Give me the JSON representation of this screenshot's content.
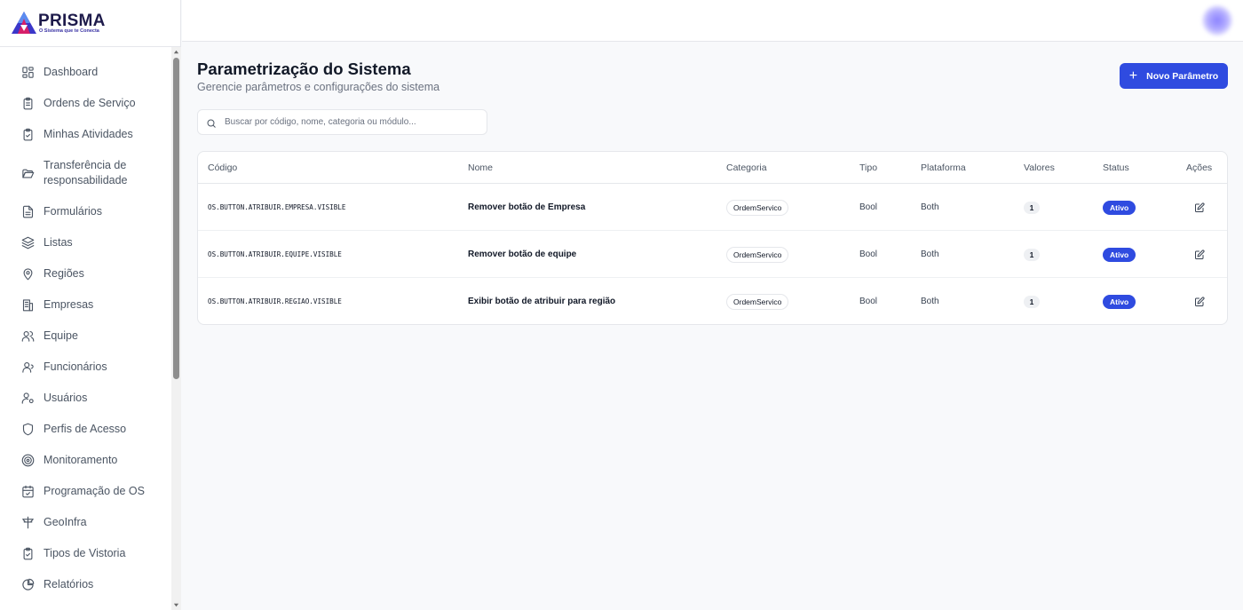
{
  "brand": {
    "name": "PRISMA",
    "tagline": "O Sistema que te Conecta"
  },
  "sidebar": {
    "items": [
      {
        "label": "Dashboard",
        "icon": "layout-grid-icon"
      },
      {
        "label": "Ordens de Serviço",
        "icon": "clipboard-icon"
      },
      {
        "label": "Minhas Atividades",
        "icon": "clipboard-check-icon"
      },
      {
        "label": "Transferência de responsabilidade",
        "icon": "folder-open-icon"
      },
      {
        "label": "Formulários",
        "icon": "file-text-icon"
      },
      {
        "label": "Listas",
        "icon": "layers-icon"
      },
      {
        "label": "Regiões",
        "icon": "map-pin-icon"
      },
      {
        "label": "Empresas",
        "icon": "building-icon"
      },
      {
        "label": "Equipe",
        "icon": "users-icon"
      },
      {
        "label": "Funcionários",
        "icon": "user-group-icon"
      },
      {
        "label": "Usuários",
        "icon": "user-cog-icon"
      },
      {
        "label": "Perfis de Acesso",
        "icon": "shield-icon"
      },
      {
        "label": "Monitoramento",
        "icon": "radar-icon"
      },
      {
        "label": "Programação de OS",
        "icon": "calendar-check-icon"
      },
      {
        "label": "GeoInfra",
        "icon": "utility-pole-icon"
      },
      {
        "label": "Tipos de Vistoria",
        "icon": "clipboard-check-icon"
      },
      {
        "label": "Relatórios",
        "icon": "pie-chart-icon"
      }
    ]
  },
  "main": {
    "title": "Parametrização do Sistema",
    "subtitle": "Gerencie parâmetros e configurações do sistema",
    "new_button": "Novo Parâmetro",
    "search": {
      "placeholder": "Buscar por código, nome, categoria ou módulo...",
      "value": ""
    }
  },
  "table": {
    "columns": [
      "Código",
      "Nome",
      "Categoria",
      "Tipo",
      "Plataforma",
      "Valores",
      "Status",
      "Ações"
    ],
    "rows": [
      {
        "codigo": "OS.BUTTON.ATRIBUIR.EMPRESA.VISIBLE",
        "nome": "Remover botão de Empresa",
        "categoria": "OrdemServico",
        "tipo": "Bool",
        "plataforma": "Both",
        "valores": "1",
        "status": "Ativo"
      },
      {
        "codigo": "OS.BUTTON.ATRIBUIR.EQUIPE.VISIBLE",
        "nome": "Remover botão de equipe",
        "categoria": "OrdemServico",
        "tipo": "Bool",
        "plataforma": "Both",
        "valores": "1",
        "status": "Ativo"
      },
      {
        "codigo": "OS.BUTTON.ATRIBUIR.REGIAO.VISIBLE",
        "nome": "Exibir botão de atribuir para região",
        "categoria": "OrdemServico",
        "tipo": "Bool",
        "plataforma": "Both",
        "valores": "1",
        "status": "Ativo"
      }
    ]
  },
  "colors": {
    "primary": "#2f4be0",
    "background": "#f8f9fb",
    "sidebar": "#ffffff"
  }
}
